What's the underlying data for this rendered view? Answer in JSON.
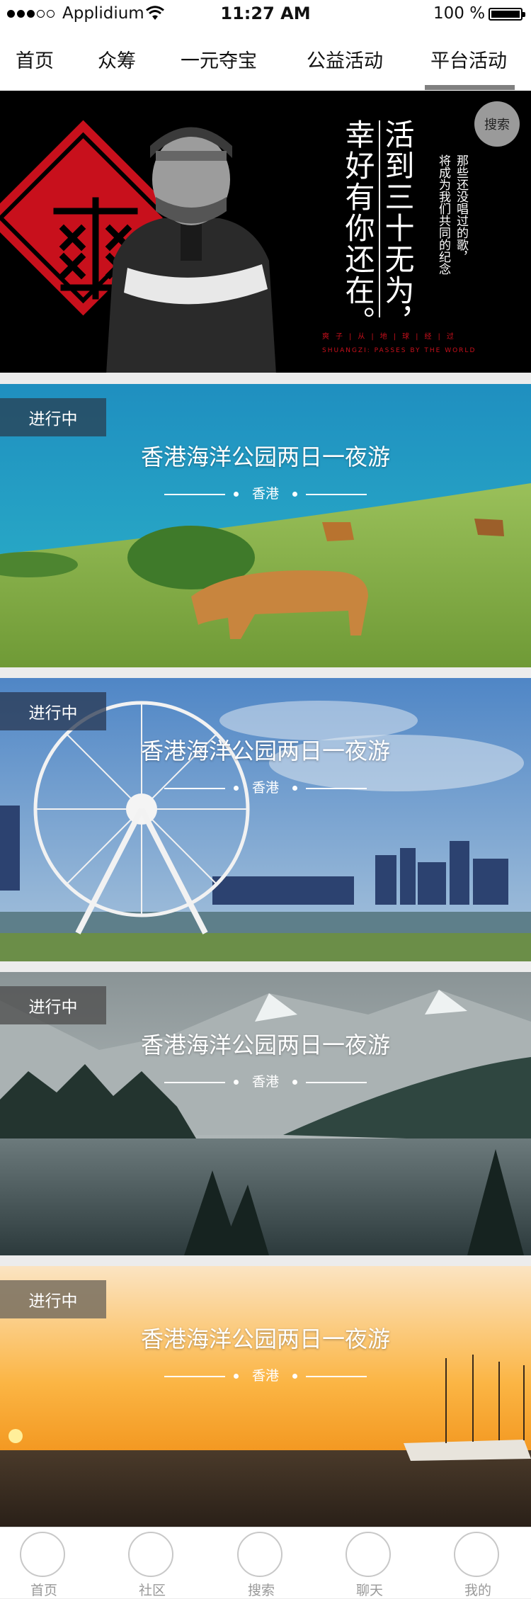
{
  "status_bar": {
    "carrier": "Applidium",
    "time": "11:27 AM",
    "battery": "100 %"
  },
  "nav": {
    "tabs": [
      {
        "label": "首页"
      },
      {
        "label": "众筹"
      },
      {
        "label": "一元夺宝"
      },
      {
        "label": "公益活动"
      },
      {
        "label": "平台活动"
      }
    ],
    "active_tab": "平台活动"
  },
  "hero": {
    "title_col1": "活到三十无为，",
    "title_col2": "幸好有你还在。",
    "subtitle_col1": "那些还没唱过的歌，",
    "subtitle_col2": "将成为我们共同的纪念",
    "red_line_1": "爽子|从|地|球|经|过",
    "red_line_2": "SHUANGZI: PASSES BY THE WORLD",
    "search_label": "搜索",
    "accent_color": "#c8101c"
  },
  "activities": [
    {
      "status": "进行中",
      "title": "香港海洋公园两日一夜游",
      "location": "香港",
      "scene": "coastal-meadow-cows"
    },
    {
      "status": "进行中",
      "title": "香港海洋公园两日一夜游",
      "location": "香港",
      "scene": "ferris-wheel-harbour"
    },
    {
      "status": "进行中",
      "title": "香港海洋公园两日一夜游",
      "location": "香港",
      "scene": "mountain-lake-forest"
    },
    {
      "status": "进行中",
      "title": "香港海洋公园两日一夜游",
      "location": "香港",
      "scene": "sunset-sea-ship"
    }
  ],
  "tab_bar": {
    "items": [
      {
        "label": "首页",
        "icon": "home-icon"
      },
      {
        "label": "社区",
        "icon": "community-icon"
      },
      {
        "label": "搜索",
        "icon": "search-icon"
      },
      {
        "label": "聊天",
        "icon": "chat-icon"
      },
      {
        "label": "我的",
        "icon": "profile-icon"
      }
    ]
  }
}
